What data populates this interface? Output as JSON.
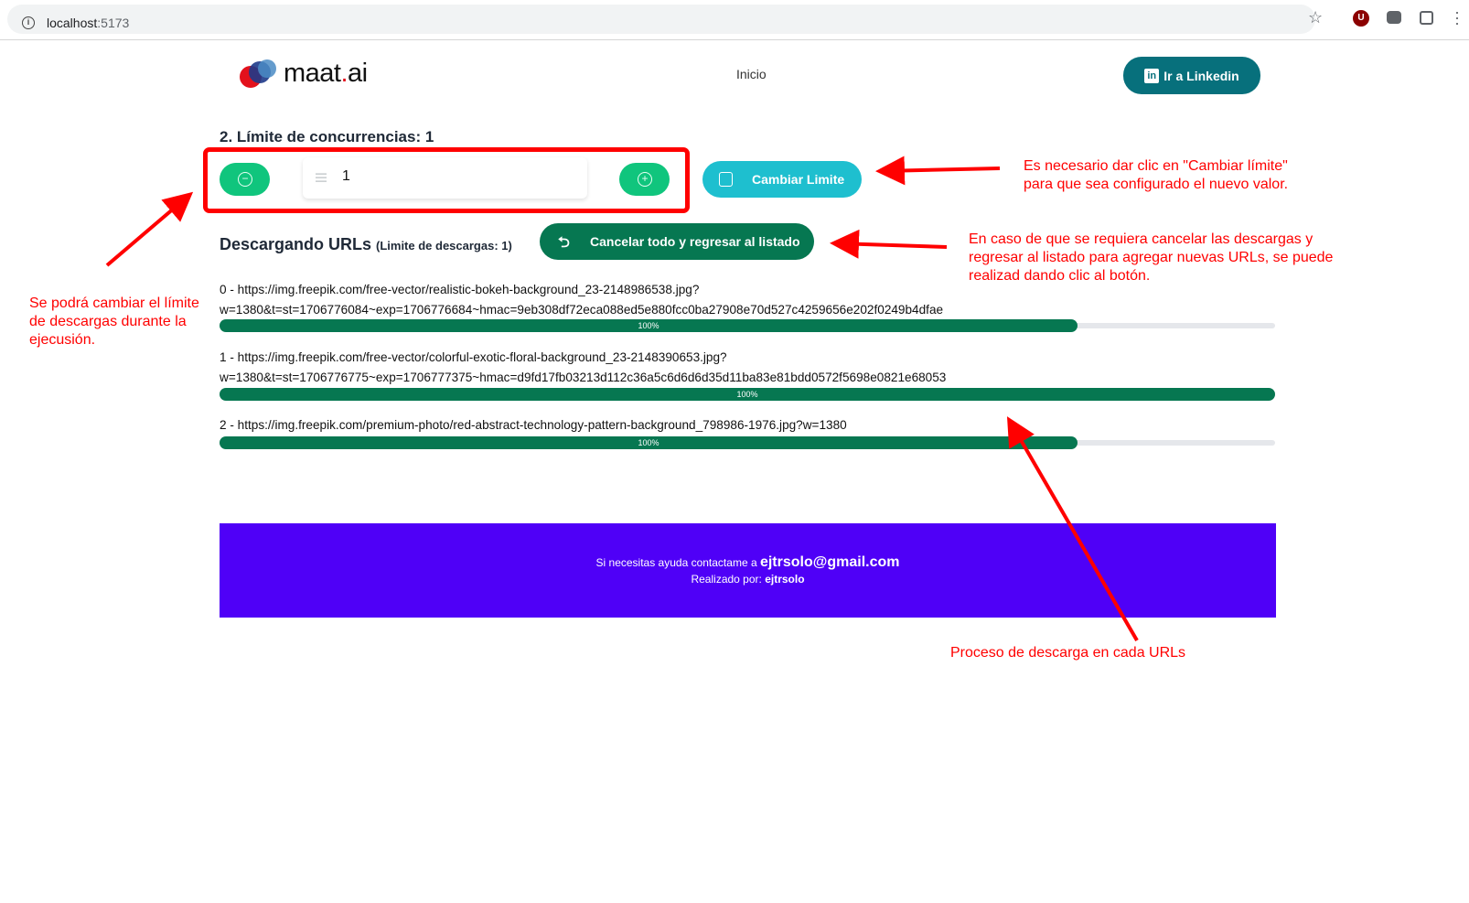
{
  "browser": {
    "url_host": "localhost",
    "url_port": ":5173",
    "ext_badge": "U"
  },
  "header": {
    "logo_text": "maat",
    "logo_dot": ".",
    "logo_suffix": "ai",
    "nav_inicio": "Inicio",
    "linkedin_label": "Ir a Linkedin",
    "linkedin_icon_text": "in"
  },
  "limit": {
    "title": "2. Límite de concurrencias: 1",
    "value": "1",
    "change_button": "Cambiar Limite"
  },
  "downloads": {
    "title": "Descargando URLs",
    "subtitle": "(Limite de descargas: 1)",
    "cancel_button": "Cancelar todo y regresar al listado",
    "items": [
      {
        "line1": "0 - https://img.freepik.com/free-vector/realistic-bokeh-background_23-2148986538.jpg?",
        "line2": "w=1380&t=st=1706776084~exp=1706776684~hmac=9eb308df72eca088ed5e880fcc0ba27908e70d527c4259656e202f0249b4dfae",
        "progress_label": "100%",
        "progress": 100
      },
      {
        "line1": "1 - https://img.freepik.com/free-vector/colorful-exotic-floral-background_23-2148390653.jpg?",
        "line2": "w=1380&t=st=1706776775~exp=1706777375~hmac=d9fd17fb03213d112c36a5c6d6d6d35d11ba83e81bdd0572f5698e0821e68053",
        "progress_label": "100%",
        "progress": 100
      },
      {
        "line1": "2 - https://img.freepik.com/premium-photo/red-abstract-technology-pattern-background_798986-1976.jpg?w=1380",
        "line2": "",
        "progress_label": "100%",
        "progress": 100
      }
    ]
  },
  "footer": {
    "help_text": "Si necesitas ayuda contactame a ",
    "email": "ejtrsolo@gmail.com",
    "made_by": "Realizado por: ",
    "author": "ejtrsolo"
  },
  "annotations": {
    "left_note": [
      "Se podrá cambiar el límite",
      "de descargas durante la",
      "ejecusión."
    ],
    "change_note": [
      "Es necesario dar clic en \"Cambiar límite\"",
      "para que sea configurado el nuevo valor."
    ],
    "cancel_note": [
      "En caso de que se requiera cancelar las descargas y",
      "regresar al listado para agregar nuevas URLs, se puede",
      "realizad dando clic al botón."
    ],
    "progress_note": "Proceso de descarga en cada URLs"
  },
  "colors": {
    "annotation_red": "#ff0000",
    "progress_green": "#067751",
    "action_green": "#10c57d",
    "cyan": "#1ebfcf",
    "linkedin_teal": "#07707c",
    "footer_purple": "#4f00f7"
  }
}
